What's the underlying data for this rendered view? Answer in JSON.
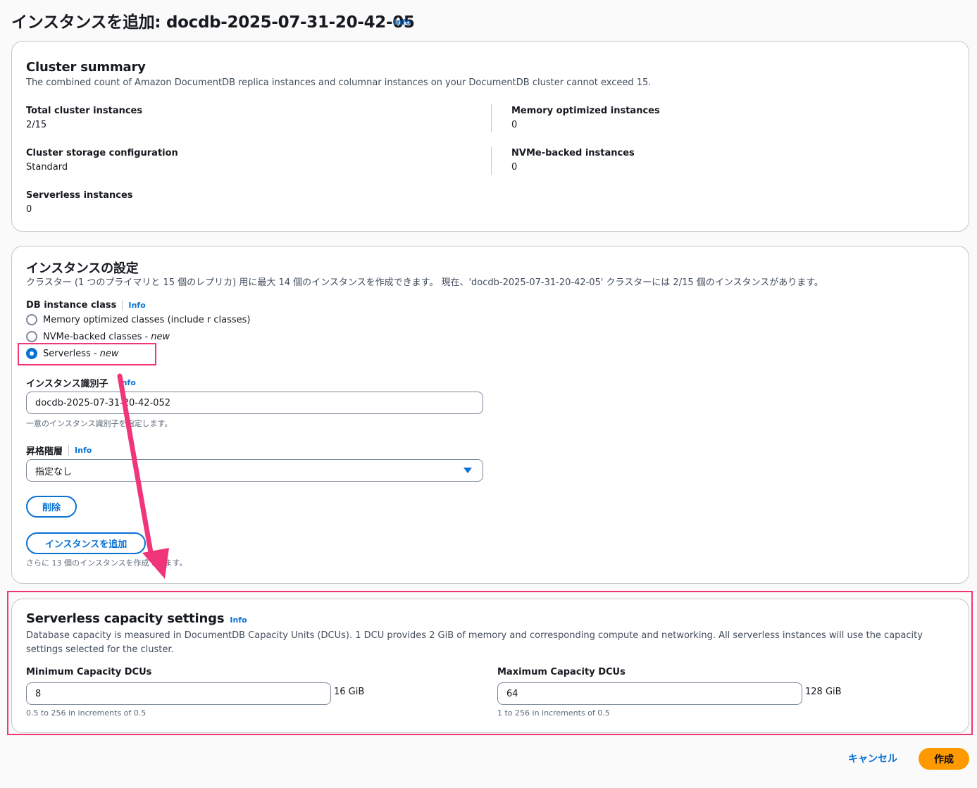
{
  "page": {
    "title": "インスタンスを追加: docdb-2025-07-31-20-42-05",
    "info": "Info"
  },
  "summary": {
    "heading": "Cluster summary",
    "description": "The combined count of Amazon DocumentDB replica instances and columnar instances on your DocumentDB cluster cannot exceed 15.",
    "total_instances_label": "Total cluster instances",
    "total_instances_value": "2/15",
    "storage_label": "Cluster storage configuration",
    "storage_value": "Standard",
    "serverless_label": "Serverless instances",
    "serverless_value": "0",
    "memory_label": "Memory optimized instances",
    "memory_value": "0",
    "nvme_label": "NVMe-backed instances",
    "nvme_value": "0"
  },
  "settings": {
    "heading": "インスタンスの設定",
    "description": "クラスター (1 つのプライマリと 15 個のレプリカ) 用に最大 14 個のインスタンスを作成できます。 現在、'docdb-2025-07-31-20-42-05' クラスターには 2/15 個のインスタンスがあります。",
    "class_label": "DB instance class",
    "class_info": "Info",
    "class_options": [
      {
        "label": "Memory optimized classes (include r classes)",
        "suffix": "",
        "checked": false
      },
      {
        "label": "NVMe-backed classes - ",
        "suffix": "new",
        "checked": false
      },
      {
        "label": "Serverless - ",
        "suffix": "new",
        "checked": true
      }
    ],
    "identifier_label": "インスタンス識別子",
    "identifier_info": "Info",
    "identifier_value": "docdb-2025-07-31-20-42-052",
    "identifier_hint": "一意のインスタンス識別子を指定します。",
    "tier_label": "昇格階層",
    "tier_info": "Info",
    "tier_value": "指定なし",
    "remove_button": "削除",
    "add_button": "インスタンスを追加",
    "add_hint": "さらに 13 個のインスタンスを作成できます。"
  },
  "capacity": {
    "heading": "Serverless capacity settings",
    "info": "Info",
    "description": "Database capacity is measured in DocumentDB Capacity Units (DCUs). 1 DCU provides 2 GiB of memory and corresponding compute and networking. All serverless instances will use the capacity settings selected for the cluster.",
    "min_label": "Minimum Capacity DCUs",
    "min_value": "8",
    "min_unit": "16 GiB",
    "min_hint": "0.5 to 256 in increments of 0.5",
    "max_label": "Maximum Capacity DCUs",
    "max_value": "64",
    "max_unit": "128 GiB",
    "max_hint": "1 to 256 in increments of 0.5"
  },
  "footer": {
    "cancel": "キャンセル",
    "create": "作成"
  },
  "colors": {
    "accent": "#0972d3",
    "primary_button": "#ff9900",
    "annotation": "#f0357a"
  }
}
